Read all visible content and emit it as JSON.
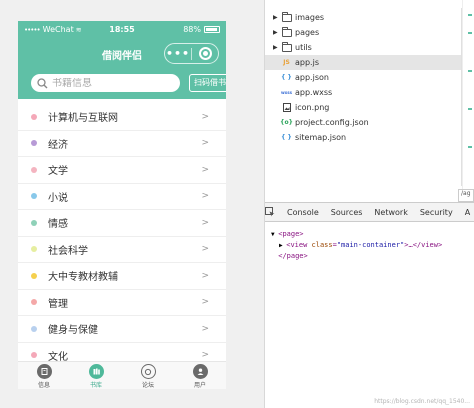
{
  "phone": {
    "status_bar": {
      "carrier": "WeChat",
      "time": "18:55",
      "battery": "88%"
    },
    "nav_title": "借阅伴侣",
    "capsule_menu": "•••",
    "search": {
      "placeholder": "书籍信息",
      "scan_label": "扫码借书"
    },
    "categories": [
      {
        "label": "计算机与互联网",
        "color": "#f4a8b8"
      },
      {
        "label": "经济",
        "color": "#b79ad6"
      },
      {
        "label": "文学",
        "color": "#f4b4c0"
      },
      {
        "label": "小说",
        "color": "#88c8ea"
      },
      {
        "label": "情感",
        "color": "#8fd1b8"
      },
      {
        "label": "社会科学",
        "color": "#e6eea0"
      },
      {
        "label": "大中专教材教辅",
        "color": "#f5d04e"
      },
      {
        "label": "管理",
        "color": "#f4a8a8"
      },
      {
        "label": "健身与保健",
        "color": "#b8d0ee"
      },
      {
        "label": "文化",
        "color": "#f4a8b8"
      }
    ],
    "arrow": ">",
    "tabs": [
      {
        "label": "信息",
        "icon": "book-icon"
      },
      {
        "label": "书库",
        "icon": "library-icon"
      },
      {
        "label": "论坛",
        "icon": "forum-icon"
      },
      {
        "label": "用户",
        "icon": "user-icon"
      }
    ]
  },
  "file_tree": {
    "items": [
      {
        "name": "images",
        "type": "folder"
      },
      {
        "name": "pages",
        "type": "folder"
      },
      {
        "name": "utils",
        "type": "folder"
      },
      {
        "name": "app.js",
        "type": "js",
        "badge": "JS"
      },
      {
        "name": "app.json",
        "type": "json",
        "badge": "{ }"
      },
      {
        "name": "app.wxss",
        "type": "wxss",
        "badge": "wxss"
      },
      {
        "name": "icon.png",
        "type": "image"
      },
      {
        "name": "project.config.json",
        "type": "config",
        "badge": "{o}"
      },
      {
        "name": "sitemap.json",
        "type": "json",
        "badge": "{ }"
      }
    ],
    "truncated_tab": "/ag"
  },
  "devtools": {
    "tabs": [
      "Console",
      "Sources",
      "Network",
      "Security",
      "A"
    ],
    "code": {
      "page_open": "<page>",
      "view_tag": "<view",
      "attr_name": "class",
      "attr_eq": "=",
      "attr_value": "\"main-container\"",
      "view_rest": ">…</view>",
      "page_close": "</page>"
    }
  },
  "watermark": "https://blog.csdn.net/qq_1540...",
  "colors": {
    "accent": "#5fc0a6",
    "selected_row": "#e5e5e5",
    "js_icon": "#e8a23a",
    "json_icon": "#3b8fd6",
    "wxss_icon": "#3b6fd6",
    "config_icon": "#2aa35a"
  }
}
